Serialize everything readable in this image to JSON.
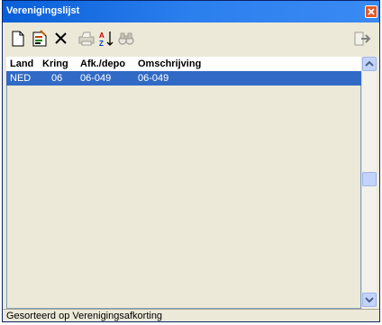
{
  "window": {
    "title": "Verenigingslijst"
  },
  "toolbar": {
    "buttons": [
      {
        "icon": "new-document-icon"
      },
      {
        "icon": "edit-document-icon"
      },
      {
        "icon": "delete-icon"
      },
      {
        "icon": "print-icon"
      },
      {
        "icon": "sort-icon"
      },
      {
        "icon": "find-icon"
      },
      {
        "icon": "exit-icon"
      }
    ]
  },
  "list": {
    "columns": [
      "Land",
      "Kring",
      "Afk./depo",
      "Omschrijving"
    ],
    "rows": [
      {
        "land": "NED",
        "kring": "06",
        "afk": "06-049",
        "omschrijving": "06-049",
        "selected": true
      }
    ]
  },
  "status": {
    "text": "Gesorteerd op Verenigingsafkorting"
  },
  "colors": {
    "selection": "#316ac5",
    "titlebar": "#0a5fd8",
    "window_bg": "#ece9d8"
  }
}
